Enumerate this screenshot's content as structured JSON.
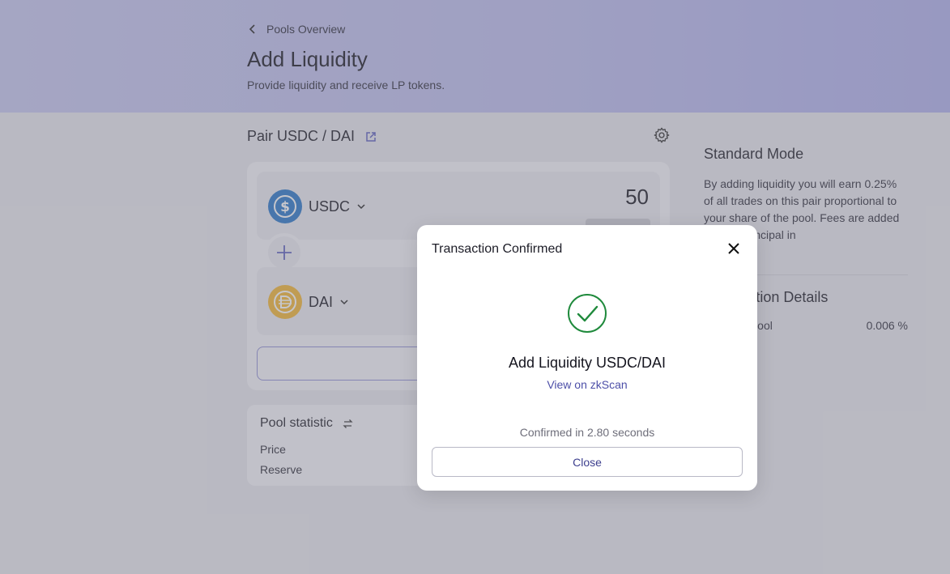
{
  "header": {
    "back_label": "Pools Overview",
    "title": "Add Liquidity",
    "subtitle": "Provide liquidity and receive LP tokens."
  },
  "pair": {
    "title": "Pair USDC / DAI"
  },
  "tokens": [
    {
      "symbol": "USDC",
      "amount": "50"
    },
    {
      "symbol": "DAI",
      "amount": ""
    }
  ],
  "pool_statistic": {
    "title": "Pool statistic",
    "rows": [
      {
        "label": "Price"
      },
      {
        "label": "Reserve"
      }
    ]
  },
  "side": {
    "title": "Standard Mode",
    "description": "By adding liquidity you will earn 0.25% of all trades on this pair proportional to your share of the pool. Fees are added to your principal in",
    "details_title": "Transaction Details",
    "details_row": {
      "label": "Share of Pool",
      "value": "0.006 %"
    }
  },
  "modal": {
    "title": "Transaction Confirmed",
    "heading": "Add Liquidity USDC/DAI",
    "link": "View on zkScan",
    "confirmed": "Confirmed in 2.80 seconds",
    "close_label": "Close"
  },
  "colors": {
    "accent": "#4d4fa8",
    "success": "#1f8a3c",
    "usdc": "#2775ca",
    "dai": "#f4b731"
  }
}
